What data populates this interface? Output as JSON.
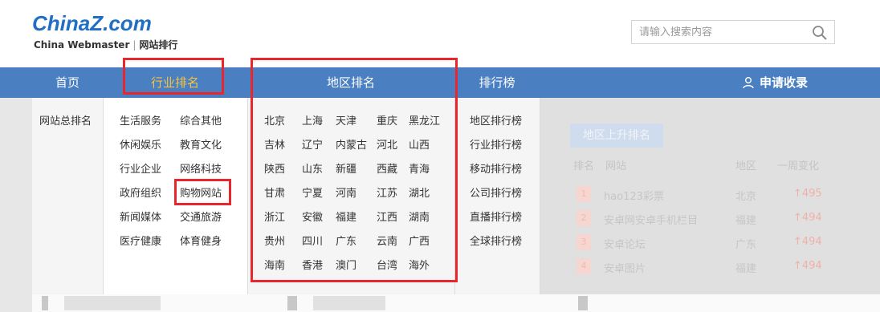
{
  "header": {
    "logo_text_main": "China",
    "logo_text_z": "Z",
    "logo_text_tail": ".com",
    "logo_sub_left": "China Webmaster",
    "logo_sub_divider": "|",
    "logo_sub_right": "网站排行",
    "search_placeholder": "请输入搜索内容"
  },
  "nav": {
    "home": "首页",
    "industry": "行业排名",
    "region": "地区排名",
    "rank_list": "排行榜",
    "apply": "申请收录"
  },
  "menu": {
    "site_total": "网站总排名",
    "industries": [
      [
        "生活服务",
        "综合其他"
      ],
      [
        "休闲娱乐",
        "教育文化"
      ],
      [
        "行业企业",
        "网络科技"
      ],
      [
        "政府组织",
        "购物网站"
      ],
      [
        "新闻媒体",
        "交通旅游"
      ],
      [
        "医疗健康",
        "体育健身"
      ]
    ],
    "regions": [
      [
        "北京",
        "上海",
        "天津",
        "重庆",
        "黑龙江"
      ],
      [
        "吉林",
        "辽宁",
        "内蒙古",
        "河北",
        "山西"
      ],
      [
        "陕西",
        "山东",
        "新疆",
        "西藏",
        "青海"
      ],
      [
        "甘肃",
        "宁夏",
        "河南",
        "江苏",
        "湖北"
      ],
      [
        "浙江",
        "安徽",
        "福建",
        "江西",
        "湖南"
      ],
      [
        "贵州",
        "四川",
        "广东",
        "云南",
        "广西"
      ],
      [
        "海南",
        "香港",
        "澳门",
        "台湾",
        "海外"
      ]
    ],
    "rank_lists": [
      "地区排行榜",
      "行业排行榜",
      "移动排行榜",
      "公司排行榜",
      "直播排行榜",
      "全球排行榜"
    ]
  },
  "panel": {
    "title": "地区上升排名",
    "head_rank": "排名",
    "head_site": "网站",
    "head_area": "地区",
    "head_change": "一周变化",
    "rows": [
      {
        "num": "1",
        "site": "hao123彩票",
        "area": "北京",
        "change": "↑495"
      },
      {
        "num": "2",
        "site": "安卓网安卓手机栏目",
        "area": "福建",
        "change": "↑494"
      },
      {
        "num": "3",
        "site": "安卓论坛",
        "area": "广东",
        "change": "↑494"
      },
      {
        "num": "4",
        "site": "安卓图片",
        "area": "福建",
        "change": "↑494"
      }
    ]
  },
  "colors": {
    "nav_bg": "#4a7fc1",
    "active_text": "#f5c443",
    "highlight_box": "#e8262b",
    "brand_blue": "#1f6fc4"
  }
}
